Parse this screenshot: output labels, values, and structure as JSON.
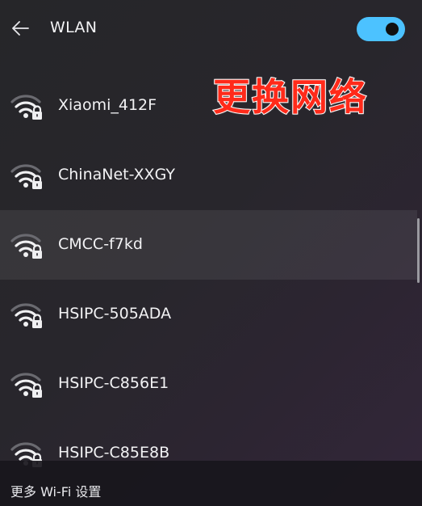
{
  "header": {
    "back_icon": "back-arrow-icon",
    "title": "WLAN",
    "toggle_on": true,
    "accent_color": "#4cc2ff"
  },
  "overlay": {
    "text": "更换网络",
    "color": "#ff2a1a"
  },
  "networks": [
    {
      "name": "Xiaomi_412F",
      "icon": "wifi-secured-icon",
      "selected": false
    },
    {
      "name": "ChinaNet-XXGY",
      "icon": "wifi-secured-icon",
      "selected": false
    },
    {
      "name": "CMCC-f7kd",
      "icon": "wifi-secured-icon",
      "selected": true
    },
    {
      "name": "HSIPC-505ADA",
      "icon": "wifi-secured-icon",
      "selected": false
    },
    {
      "name": "HSIPC-C856E1",
      "icon": "wifi-secured-icon",
      "selected": false
    },
    {
      "name": "HSIPC-C85E8B",
      "icon": "wifi-secured-icon",
      "selected": false
    }
  ],
  "footer": {
    "link_label": "更多 Wi-Fi 设置"
  }
}
